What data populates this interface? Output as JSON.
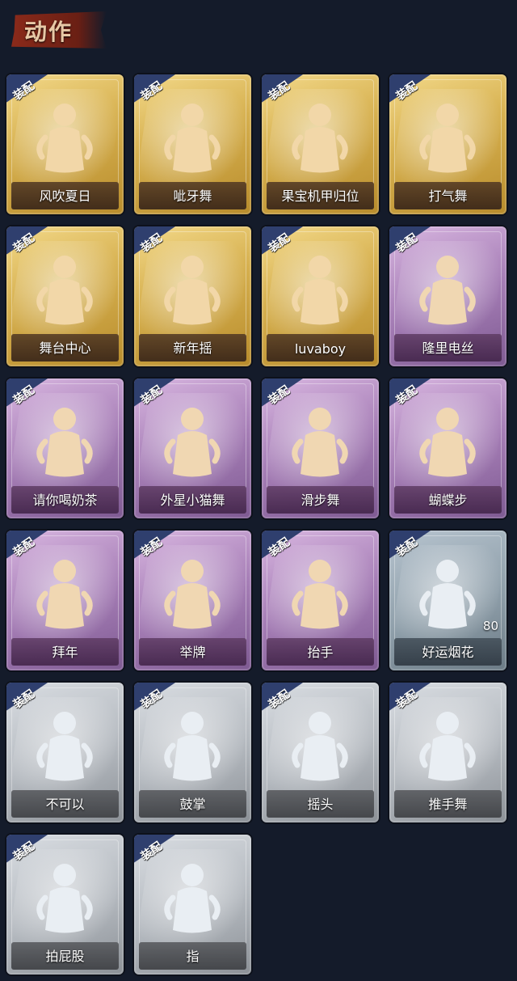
{
  "header": {
    "title": "动作"
  },
  "equip_label": "装配",
  "cards": [
    {
      "label": "风吹夏日",
      "tier": "gold",
      "icon": "wind-dance-icon"
    },
    {
      "label": "呲牙舞",
      "tier": "gold",
      "icon": "grin-dance-icon"
    },
    {
      "label": "果宝机甲归位",
      "tier": "gold",
      "icon": "mecha-pose-icon"
    },
    {
      "label": "打气舞",
      "tier": "gold",
      "icon": "cheer-dance-icon"
    },
    {
      "label": "舞台中心",
      "tier": "gold",
      "icon": "stage-center-icon"
    },
    {
      "label": "新年摇",
      "tier": "gold",
      "icon": "new-year-shake-icon"
    },
    {
      "label": "luvaboy",
      "tier": "gold",
      "icon": "luvaboy-icon"
    },
    {
      "label": "隆里电丝",
      "tier": "purple",
      "icon": "electric-dance-icon"
    },
    {
      "label": "请你喝奶茶",
      "tier": "purple",
      "icon": "milk-tea-icon"
    },
    {
      "label": "外星小猫舞",
      "tier": "purple",
      "icon": "alien-cat-dance-icon"
    },
    {
      "label": "滑步舞",
      "tier": "purple",
      "icon": "slide-dance-icon"
    },
    {
      "label": "蝴蝶步",
      "tier": "purple",
      "icon": "butterfly-step-icon"
    },
    {
      "label": "拜年",
      "tier": "purple",
      "icon": "new-year-greeting-icon"
    },
    {
      "label": "举牌",
      "tier": "purple",
      "icon": "sign-holding-icon"
    },
    {
      "label": "抬手",
      "tier": "purple",
      "icon": "raise-hand-icon"
    },
    {
      "label": "好运烟花",
      "tier": "steel",
      "icon": "firework-icon",
      "count": "80"
    },
    {
      "label": "不可以",
      "tier": "gray",
      "icon": "finger-no-icon"
    },
    {
      "label": "鼓掌",
      "tier": "gray",
      "icon": "clap-icon"
    },
    {
      "label": "摇头",
      "tier": "gray",
      "icon": "head-shake-icon"
    },
    {
      "label": "推手舞",
      "tier": "gray",
      "icon": "push-hand-dance-icon"
    },
    {
      "label": "拍屁股",
      "tier": "gray",
      "icon": "butt-pat-icon"
    },
    {
      "label": "指",
      "tier": "gray",
      "icon": "point-icon"
    }
  ]
}
